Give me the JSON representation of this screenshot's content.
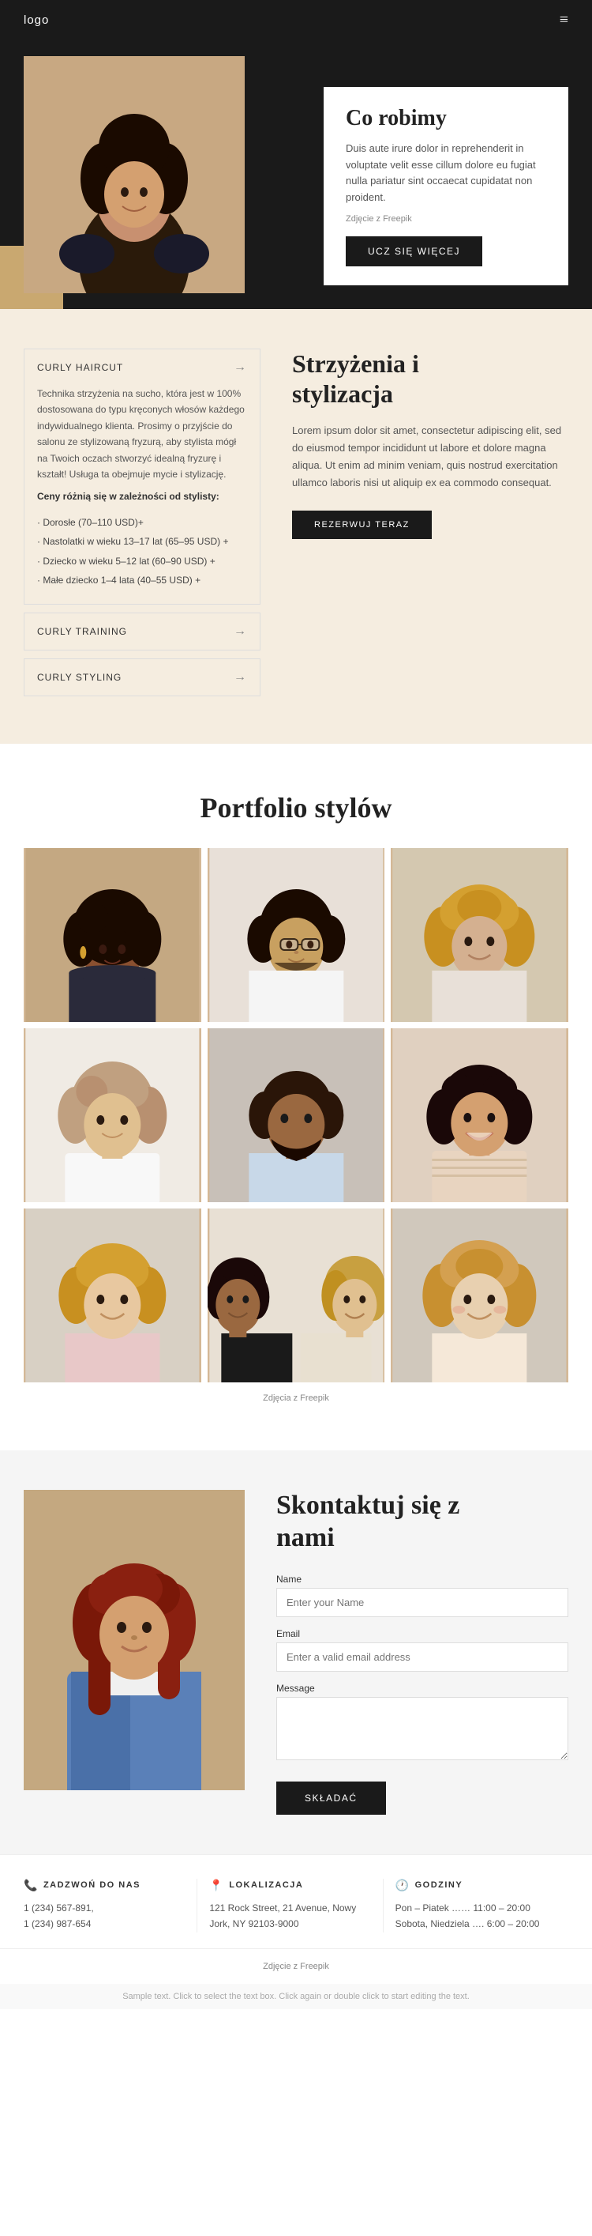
{
  "header": {
    "logo": "logo",
    "menu_icon": "≡"
  },
  "hero": {
    "title": "Co robimy",
    "text": "Duis aute irure dolor in reprehenderit in voluptate velit esse cillum dolore eu fugiat nulla pariatur sint occaecat cupidatat non proident.",
    "credit": "Zdjęcie z Freepik",
    "cta_label": "UCZ SIĘ WIĘCEJ"
  },
  "services": {
    "section_title": "Strzyżenia i\nstylizacja",
    "section_text": "Lorem ipsum dolor sit amet, consectetur adipiscing elit, sed do eiusmod tempor incididunt ut labore et dolore magna aliqua. Ut enim ad minim veniam, quis nostrud exercitation ullamco laboris nisi ut aliquip ex ea commodo consequat.",
    "cta_label": "REZERWUJ TERAZ",
    "accordion": [
      {
        "id": "curly-haircut",
        "label": "CURLY HAIRCUT",
        "expanded": true,
        "content_intro": "Technika strzyżenia na sucho, która jest w 100% dostosowana do typu kręconych włosów każdego indywidualnego klienta. Prosimy o przyjście do salonu ze stylizowaną fryzurą, aby stylista mógł na Twoich oczach stworzyć idealną fryzurę i kształt! Usługa ta obejmuje mycie i stylizację.",
        "price_title": "Ceny różnią się w zależności od stylisty:",
        "prices": [
          "· Dorosłe (70–110 USD)+",
          "· Nastolatki w wieku 13–17 lat (65–95 USD) +",
          "· Dziecko w wieku 5–12 lat (60–90 USD) +",
          "· Małe dziecko 1–4 lata (40–55 USD) +"
        ]
      },
      {
        "id": "curly-training",
        "label": "CURLY TRAINING",
        "expanded": false
      },
      {
        "id": "curly-styling",
        "label": "CURLY STYLING",
        "expanded": false
      }
    ]
  },
  "portfolio": {
    "title": "Portfolio stylów",
    "credit": "Zdjęcia z Freepik",
    "items": [
      {
        "id": 1,
        "bg": "#c4a882",
        "skin": "#b07848",
        "hair": "#2a1a0a"
      },
      {
        "id": 2,
        "bg": "#e8e0d8",
        "skin": "#d4a870",
        "hair": "#1a0a00"
      },
      {
        "id": 3,
        "bg": "#d4c8b0",
        "skin": "#c89060",
        "hair": "#c89040"
      },
      {
        "id": 4,
        "bg": "#f0ebe4",
        "skin": "#e8d0b0",
        "hair": "#c0a080"
      },
      {
        "id": 5,
        "bg": "#c8c0b8",
        "skin": "#b09070",
        "hair": "#3a2010"
      },
      {
        "id": 6,
        "bg": "#e0d0c0",
        "skin": "#c8a070",
        "hair": "#2a1a10"
      },
      {
        "id": 7,
        "bg": "#d8d0c4",
        "skin": "#d4b090",
        "hair": "#c08040"
      },
      {
        "id": 8,
        "bg": "#e8e0d4",
        "skin": "#c49060",
        "hair": "#1a0a00"
      },
      {
        "id": 9,
        "bg": "#d0c8bc",
        "skin": "#e0c0a0",
        "hair": "#d4a060"
      }
    ]
  },
  "contact": {
    "title": "Skontaktuj się z\nnami",
    "form": {
      "name_label": "Name",
      "name_placeholder": "Enter your Name",
      "email_label": "Email",
      "email_placeholder": "Enter a valid email address",
      "message_label": "Message",
      "submit_label": "SKŁADAĆ"
    }
  },
  "info": {
    "phone": {
      "icon": "📞",
      "title": "ZADZWOŃ DO NAS",
      "lines": [
        "1 (234) 567-891,",
        "1 (234) 987-654"
      ]
    },
    "address": {
      "icon": "📍",
      "title": "LOKALIZACJA",
      "lines": [
        "121 Rock Street, 21 Avenue, Nowy",
        "Jork, NY 92103-9000"
      ]
    },
    "hours": {
      "icon": "🕐",
      "title": "GODZINY",
      "lines": [
        "Pon – Piatek …… 11:00 – 20:00",
        "Sobota, Niedziela …. 6:00 – 20:00"
      ]
    }
  },
  "footer_credit": "Zdjęcie z Freepik",
  "sample_text": "Sample text. Click to select the text box. Click again or double click to start editing the text."
}
